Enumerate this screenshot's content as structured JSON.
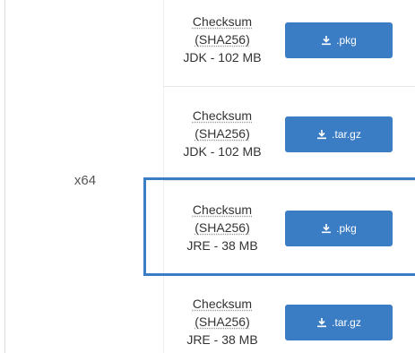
{
  "architecture": "x64",
  "rows": [
    {
      "checksum_line1": "Checksum",
      "checksum_line2": "(SHA256)",
      "size": "JDK - 102 MB",
      "button_label": ".pkg"
    },
    {
      "checksum_line1": "Checksum",
      "checksum_line2": "(SHA256)",
      "size": "JDK - 102 MB",
      "button_label": ".tar.gz"
    },
    {
      "checksum_line1": "Checksum",
      "checksum_line2": "(SHA256)",
      "size": "JRE - 38 MB",
      "button_label": ".pkg",
      "highlighted": true
    },
    {
      "checksum_line1": "Checksum",
      "checksum_line2": "(SHA256)",
      "size": "JRE - 38 MB",
      "button_label": ".tar.gz"
    }
  ],
  "colors": {
    "button": "#3b7dc4",
    "highlight": "#3b7dc4"
  },
  "icons": {
    "download": "download-icon"
  }
}
